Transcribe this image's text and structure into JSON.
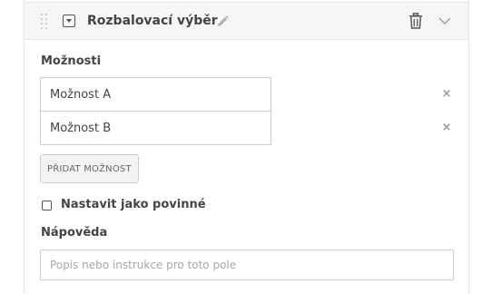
{
  "field": {
    "title": "Rozbalovací výběr",
    "type_icon": "dropdown-select-icon",
    "edit_icon": "pencil-icon",
    "delete_icon": "trash-icon",
    "collapse_icon": "chevron-down-icon",
    "drag_icon": "drag-handle-icon"
  },
  "options": {
    "label": "Možnosti",
    "items": [
      {
        "value": "Možnost A",
        "remove_glyph": "×"
      },
      {
        "value": "Možnost B",
        "remove_glyph": "×"
      }
    ],
    "add_button_label": "PŘIDAT MOŽNOST"
  },
  "required": {
    "label": "Nastavit jako povinné",
    "checked": false
  },
  "help": {
    "label": "Nápověda",
    "value": "",
    "placeholder": "Popis nebo instrukce pro toto pole"
  },
  "colors": {
    "header_background": "#f5f6f6",
    "border": "#cccccc",
    "text": "#444444",
    "muted": "#9a9a9a",
    "button_background": "#f3f3f3"
  }
}
